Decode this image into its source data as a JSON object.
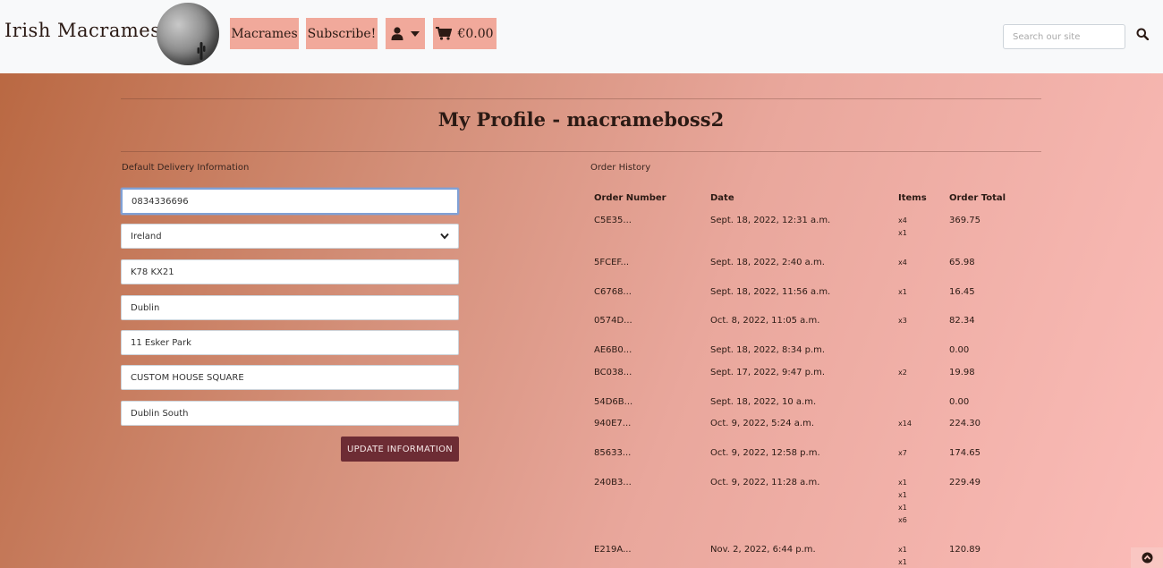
{
  "header": {
    "brand": "Irish Macrames",
    "nav": {
      "macrames": "Macrames",
      "subscribe": "Subscribe!",
      "cart_total": "€0.00"
    },
    "search": {
      "placeholder": "Search our site"
    }
  },
  "page": {
    "title": "My Profile - macrameboss2"
  },
  "delivery": {
    "label": "Default Delivery Information",
    "phone": "0834336696",
    "country": "Ireland",
    "postcode": "K78 KX21",
    "town": "Dublin",
    "street1": "11 Esker Park",
    "street2": "CUSTOM HOUSE SQUARE",
    "county": "Dublin South",
    "update_label": "UPDATE INFORMATION"
  },
  "orders": {
    "label": "Order History",
    "headers": {
      "number": "Order Number",
      "date": "Date",
      "items": "Items",
      "total": "Order Total"
    },
    "rows": [
      {
        "number": "C5E35...",
        "date": "Sept. 18, 2022, 12:31 a.m.",
        "items": [
          "x4",
          "x1"
        ],
        "total": "369.75"
      },
      {
        "number": "5FCEF...",
        "date": "Sept. 18, 2022, 2:40 a.m.",
        "items": [
          "x4"
        ],
        "total": "65.98"
      },
      {
        "number": "C6768...",
        "date": "Sept. 18, 2022, 11:56 a.m.",
        "items": [
          "x1"
        ],
        "total": "16.45"
      },
      {
        "number": "0574D...",
        "date": "Oct. 8, 2022, 11:05 a.m.",
        "items": [
          "x3"
        ],
        "total": "82.34"
      },
      {
        "number": "AE6B0...",
        "date": "Sept. 18, 2022, 8:34 p.m.",
        "items": [],
        "total": "0.00"
      },
      {
        "number": "BC038...",
        "date": "Sept. 17, 2022, 9:47 p.m.",
        "items": [
          "x2"
        ],
        "total": "19.98"
      },
      {
        "number": "54D6B...",
        "date": "Sept. 18, 2022, 10 a.m.",
        "items": [],
        "total": "0.00"
      },
      {
        "number": "940E7...",
        "date": "Oct. 9, 2022, 5:24 a.m.",
        "items": [
          "x14"
        ],
        "total": "224.30"
      },
      {
        "number": "85633...",
        "date": "Oct. 9, 2022, 12:58 p.m.",
        "items": [
          "x7"
        ],
        "total": "174.65"
      },
      {
        "number": "240B3...",
        "date": "Oct. 9, 2022, 11:28 a.m.",
        "items": [
          "x1",
          "x1",
          "x1",
          "x6"
        ],
        "total": "229.49"
      },
      {
        "number": "E219A...",
        "date": "Nov. 2, 2022, 6:44 p.m.",
        "items": [
          "x1",
          "x1"
        ],
        "total": "120.89"
      }
    ]
  }
}
